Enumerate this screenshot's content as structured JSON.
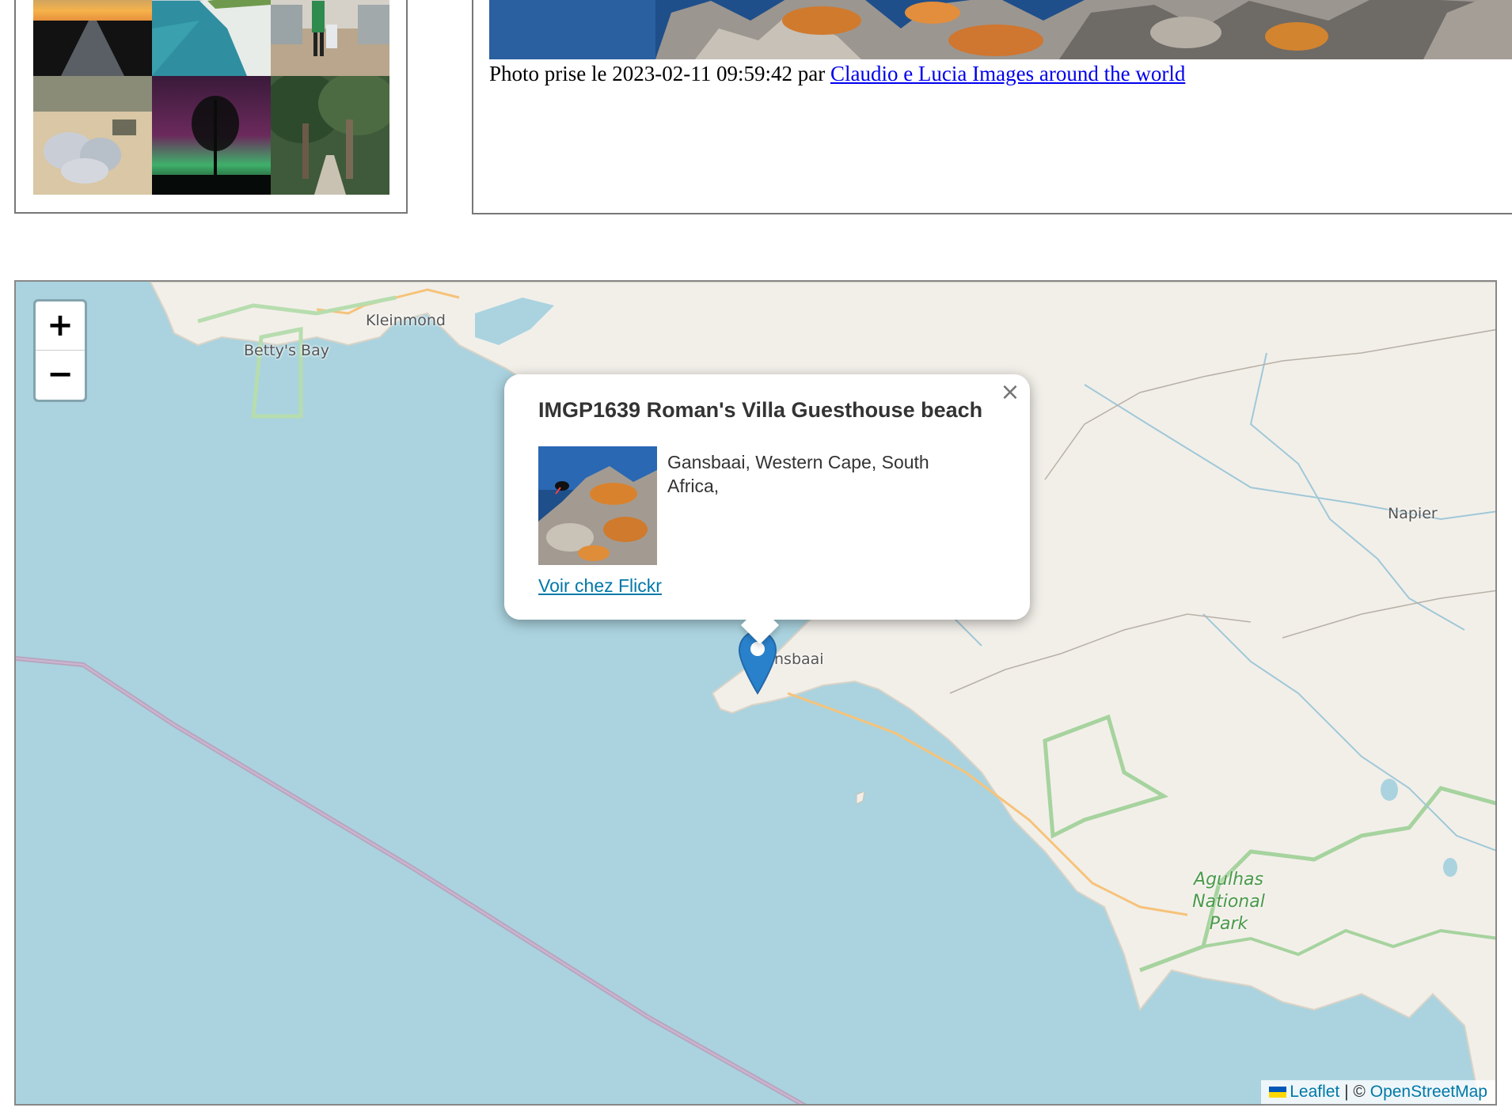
{
  "photo": {
    "caption_prefix": "Photo prise le 2023-02-11 09:59:42 par",
    "author": "Claudio e Lucia Images around the world"
  },
  "thumbnails": [
    {
      "name": "sunset-boardwalk"
    },
    {
      "name": "white-cliffs-sea"
    },
    {
      "name": "person-on-pier"
    },
    {
      "name": "trash-bags-beach"
    },
    {
      "name": "aurora-tree"
    },
    {
      "name": "forest-path"
    }
  ],
  "map": {
    "zoom_in": "+",
    "zoom_out": "−",
    "labels": {
      "bettys_bay": "Betty's Bay",
      "kleinmond": "Kleinmond",
      "napier": "Napier",
      "gansbaai": "nsbaai",
      "park_line1": "Agulhas",
      "park_line2": "National",
      "park_line3": "Park"
    },
    "popup": {
      "title": "IMGP1639 Roman's Villa Guesthouse beach",
      "location": "Gansbaai, Western Cape, South Africa,",
      "link": "Voir chez Flickr",
      "close": "×"
    },
    "attribution": {
      "leaflet": "Leaflet",
      "separator": "| ©",
      "osm": "OpenStreetMap"
    }
  },
  "colors": {
    "sea": "#aad3df",
    "land": "#f2efe9",
    "park": "#a6d39e",
    "road": "#f6c37a",
    "link": "#0078a8",
    "marker": "#2a81cb"
  }
}
